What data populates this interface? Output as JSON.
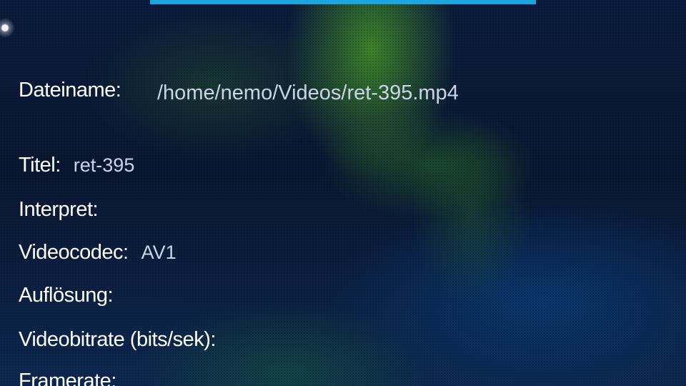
{
  "colors": {
    "accent": "#1ea5e0",
    "label": "#ffffff",
    "value": "#c9d4e6"
  },
  "details": {
    "filename": {
      "label": "Dateiname:",
      "value": "/home/nemo/Videos/ret-395.mp4"
    },
    "title": {
      "label": "Titel:",
      "value": "ret-395"
    },
    "artist": {
      "label": "Interpret:",
      "value": ""
    },
    "videocodec": {
      "label": "Videocodec:",
      "value": "AV1"
    },
    "resolution": {
      "label": "Auflösung:",
      "value": ""
    },
    "videobitrate": {
      "label": "Videobitrate (bits/sek):",
      "value": ""
    },
    "framerate": {
      "label": "Framerate:",
      "value": ""
    }
  }
}
